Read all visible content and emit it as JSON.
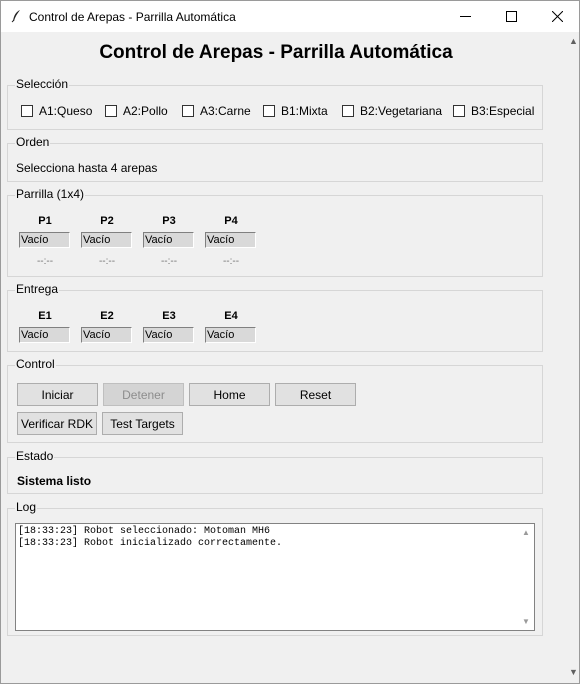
{
  "window": {
    "title": "Control de Arepas - Parrilla Automática"
  },
  "header": {
    "title": "Control de Arepas - Parrilla Automática"
  },
  "seleccion": {
    "legend": "Selección",
    "options": [
      {
        "label": "A1:Queso",
        "checked": false
      },
      {
        "label": "A2:Pollo",
        "checked": false
      },
      {
        "label": "A3:Carne",
        "checked": false
      },
      {
        "label": "B1:Mixta",
        "checked": false
      },
      {
        "label": "B2:Vegetariana",
        "checked": false
      },
      {
        "label": "B3:Especial",
        "checked": false
      }
    ]
  },
  "orden": {
    "legend": "Orden",
    "text": "Selecciona hasta 4 arepas"
  },
  "parrilla": {
    "legend": "Parrilla (1x4)",
    "slots": [
      {
        "label": "P1",
        "value": "Vacío",
        "timer": "--:--"
      },
      {
        "label": "P2",
        "value": "Vacío",
        "timer": "--:--"
      },
      {
        "label": "P3",
        "value": "Vacío",
        "timer": "--:--"
      },
      {
        "label": "P4",
        "value": "Vacío",
        "timer": "--:--"
      }
    ]
  },
  "entrega": {
    "legend": "Entrega",
    "slots": [
      {
        "label": "E1",
        "value": "Vacío"
      },
      {
        "label": "E2",
        "value": "Vacío"
      },
      {
        "label": "E3",
        "value": "Vacío"
      },
      {
        "label": "E4",
        "value": "Vacío"
      }
    ]
  },
  "control": {
    "legend": "Control",
    "buttons": {
      "iniciar": "Iniciar",
      "detener": "Detener",
      "home": "Home",
      "reset": "Reset",
      "verificar": "Verificar RDK",
      "test": "Test Targets"
    },
    "detener_enabled": false
  },
  "estado": {
    "legend": "Estado",
    "text": "Sistema listo"
  },
  "log": {
    "legend": "Log",
    "lines": [
      "[18:33:23] Robot seleccionado: Motoman MH6",
      "[18:33:23] Robot inicializado correctamente."
    ]
  },
  "icons": {
    "app": "feather-icon",
    "minimize": "minimize-icon",
    "maximize": "maximize-icon",
    "close": "close-icon",
    "scroll_up": "scroll-up-arrow-icon",
    "scroll_down": "scroll-down-arrow-icon"
  }
}
